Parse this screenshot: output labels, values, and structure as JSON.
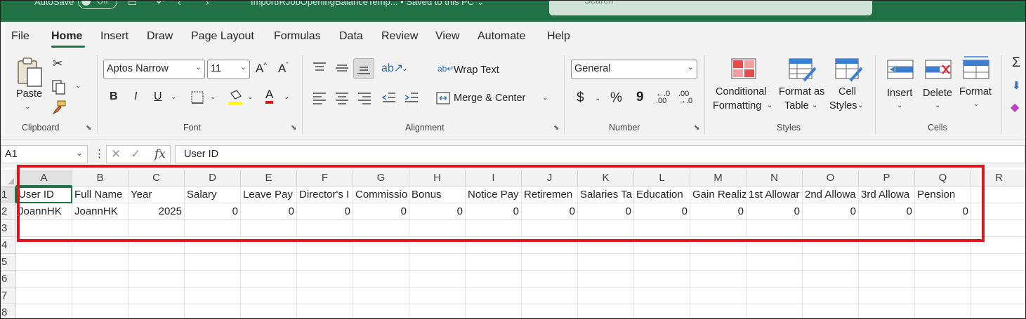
{
  "titlebar": {
    "autosave_label": "AutoSave",
    "autosave_state": "Off",
    "document_name": "ImportIRJobOpeningBalanceTemp...  •  Saved to this PC  ⌄",
    "search_placeholder": "Search"
  },
  "ribbon_tabs": [
    "File",
    "Home",
    "Insert",
    "Draw",
    "Page Layout",
    "Formulas",
    "Data",
    "Review",
    "View",
    "Automate",
    "Help"
  ],
  "active_tab": "Home",
  "clipboard": {
    "paste_label": "Paste",
    "group_label": "Clipboard"
  },
  "font": {
    "family": "Aptos Narrow",
    "size": "11",
    "group_label": "Font",
    "bold": "B",
    "italic": "I",
    "underline": "U",
    "grow": "A^",
    "shrink": "Aˇ",
    "font_color_label": "A",
    "highlight_color": "#ffff00",
    "font_color": "#e0141e"
  },
  "alignment": {
    "wrap_text": "Wrap Text",
    "merge_center": "Merge & Center",
    "group_label": "Alignment"
  },
  "number": {
    "format": "General",
    "currency": "$",
    "percent": "%",
    "comma": "9",
    "group_label": "Number"
  },
  "styles": {
    "conditional_formatting": [
      "Conditional",
      "Formatting"
    ],
    "format_as_table": [
      "Format as",
      "Table"
    ],
    "cell_styles": [
      "Cell",
      "Styles"
    ],
    "group_label": "Styles"
  },
  "cells": {
    "insert": "Insert",
    "delete": "Delete",
    "format": "Format",
    "group_label": "Cells"
  },
  "formula_bar": {
    "name_box": "A1",
    "fx": "fx",
    "content": "User ID"
  },
  "sheet": {
    "columns": [
      "A",
      "B",
      "C",
      "D",
      "E",
      "F",
      "G",
      "H",
      "I",
      "J",
      "K",
      "L",
      "M",
      "N",
      "O",
      "P",
      "Q",
      "R"
    ],
    "row_numbers": [
      "1",
      "2",
      "3",
      "4",
      "5",
      "6",
      "7",
      "8"
    ],
    "header_row": [
      "User ID",
      "Full Name",
      "Year",
      "Salary",
      "Leave Pay",
      "Director's I",
      "Commissio",
      "Bonus",
      "Notice Pay",
      "Retiremen",
      "Salaries Ta",
      "Education",
      "Gain Realiz",
      "1st Allowar",
      "2nd Allowa",
      "3rd Allowa",
      "Pension"
    ],
    "data_row": [
      "JoannHK",
      "JoannHK",
      "2025",
      "0",
      "0",
      "0",
      "0",
      "0",
      "0",
      "0",
      "0",
      "0",
      "0",
      "0",
      "0",
      "0",
      "0"
    ]
  },
  "annotation": {
    "highlight_color": "#e0141e"
  }
}
